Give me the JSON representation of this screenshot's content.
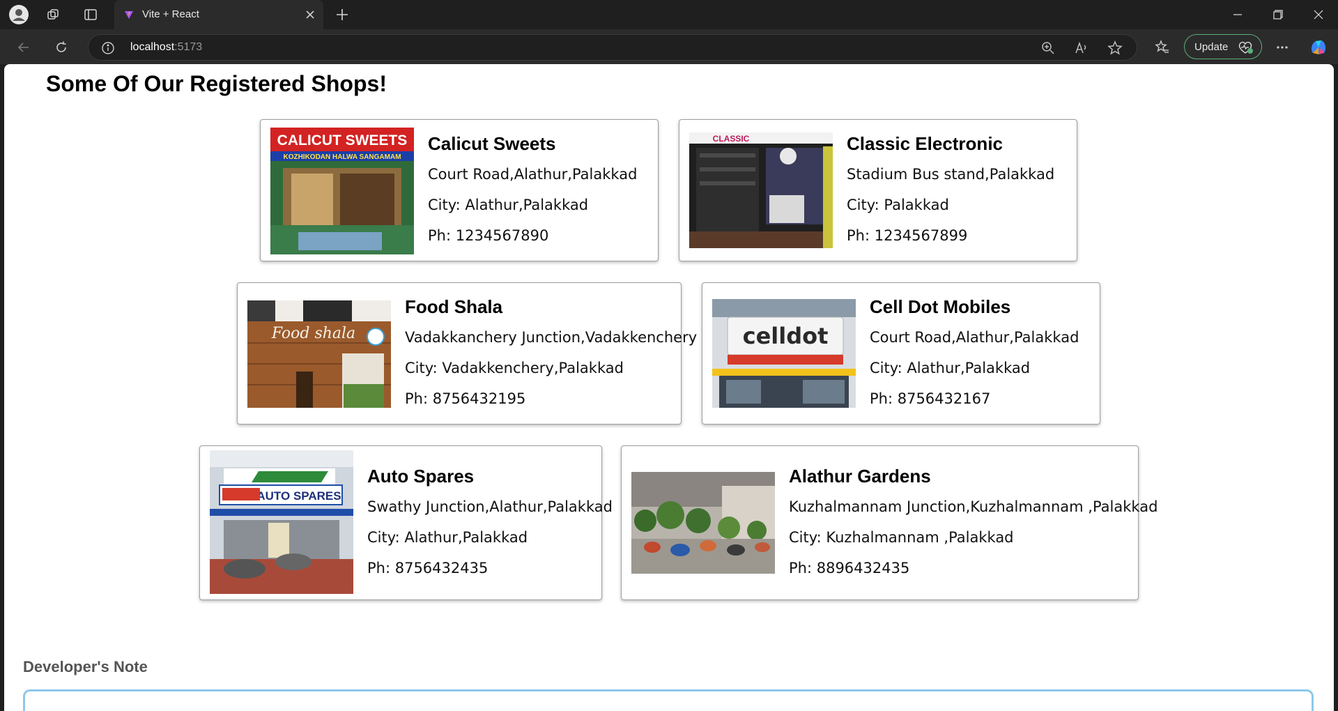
{
  "browser": {
    "tab_title": "Vite + React",
    "url_host": "localhost",
    "url_port": ":5173",
    "update_label": "Update",
    "update_badge": "1",
    "accent_color": "#5fae7d"
  },
  "page": {
    "heading": "Some Of Our Registered Shops!",
    "developer_note_label": "Developer's Note"
  },
  "shops": [
    {
      "name": "Calicut Sweets",
      "address": "Court Road,Alathur,Palakkad",
      "city": "City: Alathur,Palakkad",
      "phone": "Ph: 1234567890",
      "sign_text": "CALICUT SWEETS",
      "sign_subtext": "KOZHIKODAN HALWA SANGAMAM"
    },
    {
      "name": "Classic Electronic",
      "address": "Stadium Bus stand,Palakkad",
      "city": "City: Palakkad",
      "phone": "Ph: 1234567899",
      "sign_text": "CLASSIC"
    },
    {
      "name": "Food Shala",
      "address": "Vadakkanchery Junction,Vadakkenchery",
      "city": "City: Vadakkenchery,Palakkad",
      "phone": "Ph: 8756432195",
      "sign_text": "Food shala"
    },
    {
      "name": "Cell Dot Mobiles",
      "address": "Court Road,Alathur,Palakkad",
      "city": "City: Alathur,Palakkad",
      "phone": "Ph: 8756432167",
      "sign_text": "celldot"
    },
    {
      "name": "Auto Spares",
      "address": "Swathy Junction,Alathur,Palakkad",
      "city": "City: Alathur,Palakkad",
      "phone": "Ph: 8756432435",
      "sign_text": "AUTO SPARES"
    },
    {
      "name": "Alathur Gardens",
      "address": "Kuzhalmannam Junction,Kuzhalmannam ,Palakkad",
      "city": "City: Kuzhalmannam ,Palakkad",
      "phone": "Ph: 8896432435"
    }
  ]
}
